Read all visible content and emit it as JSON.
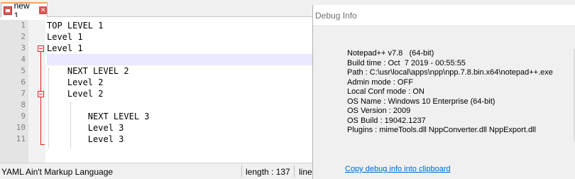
{
  "tab": {
    "label": "new 1",
    "close_icon": "close-icon",
    "file_icon": "unsaved-file-icon"
  },
  "editor": {
    "lines": [
      {
        "num": "1",
        "text": "TOP LEVEL 1"
      },
      {
        "num": "2",
        "text": "Level 1"
      },
      {
        "num": "3",
        "text": "Level 1"
      },
      {
        "num": "4",
        "text": ""
      },
      {
        "num": "5",
        "text": "    NEXT LEVEL 2"
      },
      {
        "num": "6",
        "text": "    Level 2"
      },
      {
        "num": "7",
        "text": "    Level 2"
      },
      {
        "num": "8",
        "text": ""
      },
      {
        "num": "9",
        "text": "        NEXT LEVEL 3"
      },
      {
        "num": "10",
        "text": "        Level 3"
      },
      {
        "num": "11",
        "text": "        Level 3"
      }
    ]
  },
  "statusbar": {
    "language": "YAML Ain't Markup Language",
    "length": "length : 137",
    "line": "line"
  },
  "dialog": {
    "title": "Debug Info",
    "info": [
      "Notepad++ v7.8   (64-bit)",
      "Build time : Oct  7 2019 - 00:55:55",
      "Path : C:\\usr\\local\\apps\\npp\\npp.7.8.bin.x64\\notepad++.exe",
      "Admin mode : OFF",
      "Local Conf mode : ON",
      "OS Name : Windows 10 Enterprise (64-bit)",
      "OS Version : 2009",
      "OS Build : 19042.1237",
      "Plugins : mimeTools.dll NppConverter.dll NppExport.dll"
    ],
    "copy_link": "Copy debug info into clipboard"
  },
  "colors": {
    "fold_marker": "#dd2222",
    "current_line": "#e8e8ff",
    "link": "#0066cc"
  }
}
